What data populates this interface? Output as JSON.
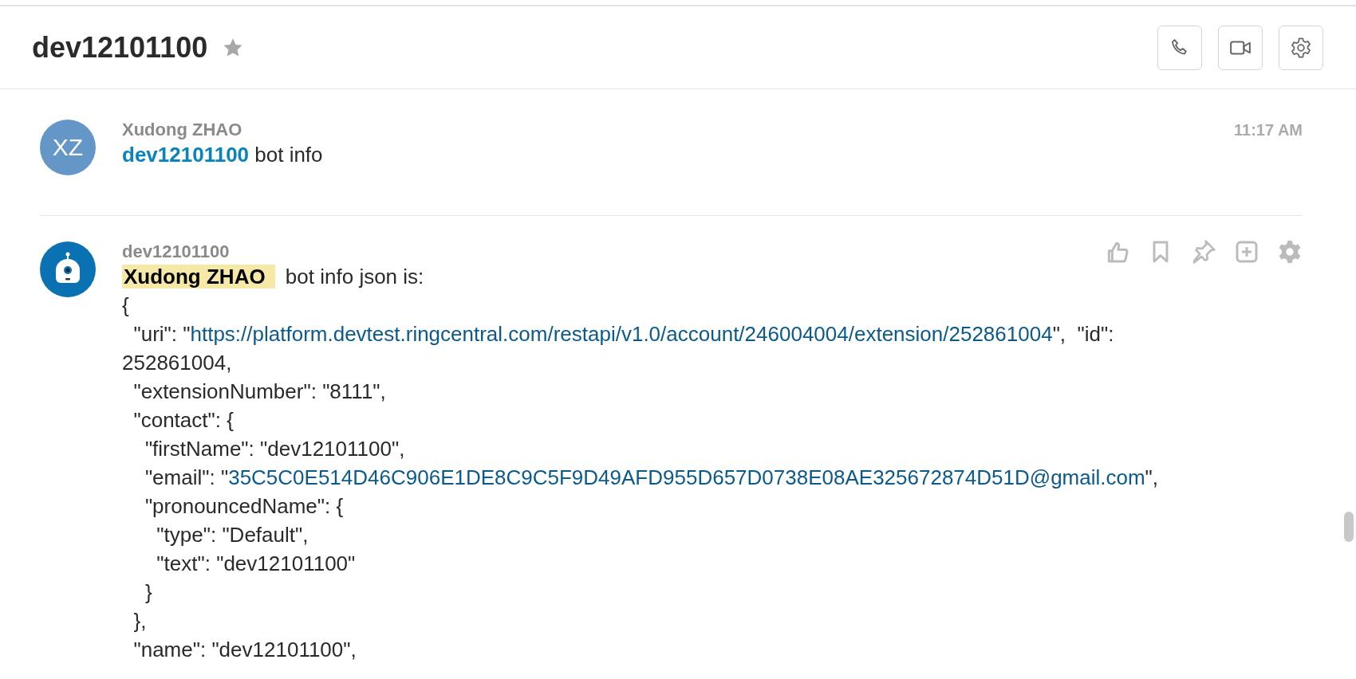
{
  "header": {
    "title": "dev12101100",
    "favorite": false,
    "actions": [
      {
        "kind": "phone"
      },
      {
        "kind": "video"
      },
      {
        "kind": "settings"
      }
    ]
  },
  "messages": [
    {
      "avatar": {
        "kind": "initials",
        "initials": "XZ"
      },
      "sender": "Xudong ZHAO",
      "time": "11:17 AM",
      "mention": {
        "text": "dev12101100",
        "kind": "link"
      },
      "text": " bot info"
    },
    {
      "avatar": {
        "kind": "bot"
      },
      "sender": "dev12101100",
      "mention": {
        "text": "Xudong ZHAO",
        "kind": "highlight"
      },
      "text": " bot info json is:",
      "actions": [
        {
          "kind": "like"
        },
        {
          "kind": "bookmark"
        },
        {
          "kind": "pin"
        },
        {
          "kind": "add"
        },
        {
          "kind": "more-settings"
        }
      ],
      "lines": [
        {
          "text": "{"
        },
        {
          "text": "  \"uri\": \"",
          "link": "https://platform.devtest.ringcentral.com/restapi/v1.0/account/246004004/extension/252861004",
          "after": "\",  \"id\":"
        },
        {
          "text": "252861004,"
        },
        {
          "text": "  \"extensionNumber\": \"8111\","
        },
        {
          "text": "  \"contact\": {"
        },
        {
          "text": "    \"firstName\": \"dev12101100\","
        },
        {
          "text": "    \"email\": \"",
          "link": "35C5C0E514D46C906E1DE8C9C5F9D49AFD955D657D0738E08AE325672874D51D@gmail.com",
          "after": "\","
        },
        {
          "text": "    \"pronouncedName\": {"
        },
        {
          "text": "      \"type\": \"Default\","
        },
        {
          "text": "      \"text\": \"dev12101100\""
        },
        {
          "text": "    }"
        },
        {
          "text": "  },"
        },
        {
          "text": "  \"name\": \"dev12101100\","
        }
      ]
    }
  ]
}
